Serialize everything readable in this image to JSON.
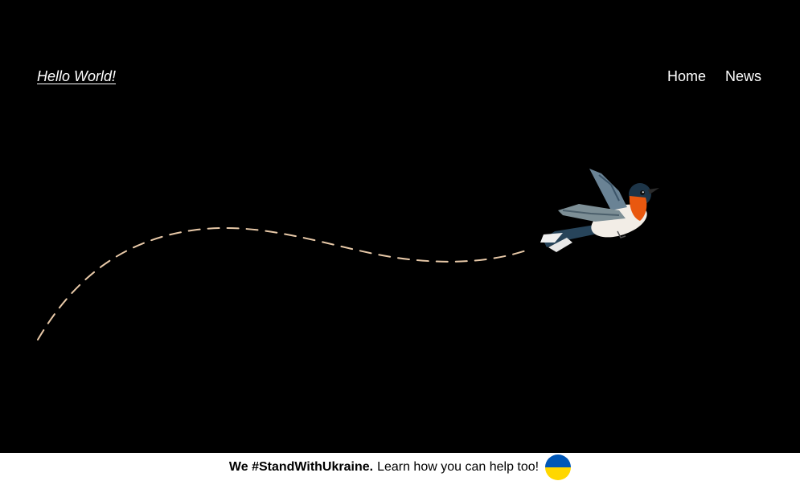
{
  "header": {
    "site_title": "Hello World!",
    "nav": [
      {
        "label": "Home"
      },
      {
        "label": "News"
      }
    ]
  },
  "hero": {
    "image": "flying-bird-with-dashed-trail",
    "trail_color": "#E8C9A8"
  },
  "banner": {
    "strong_text": "We #StandWithUkraine.",
    "link_text": "Learn how you can help too!",
    "flag_icon": "ukraine-flag-icon",
    "flag_colors": {
      "top": "#0057B7",
      "bottom": "#FFD700"
    }
  },
  "colors": {
    "background": "#000000",
    "text": "#FFFFFF",
    "banner_background": "#FFFFFF"
  }
}
